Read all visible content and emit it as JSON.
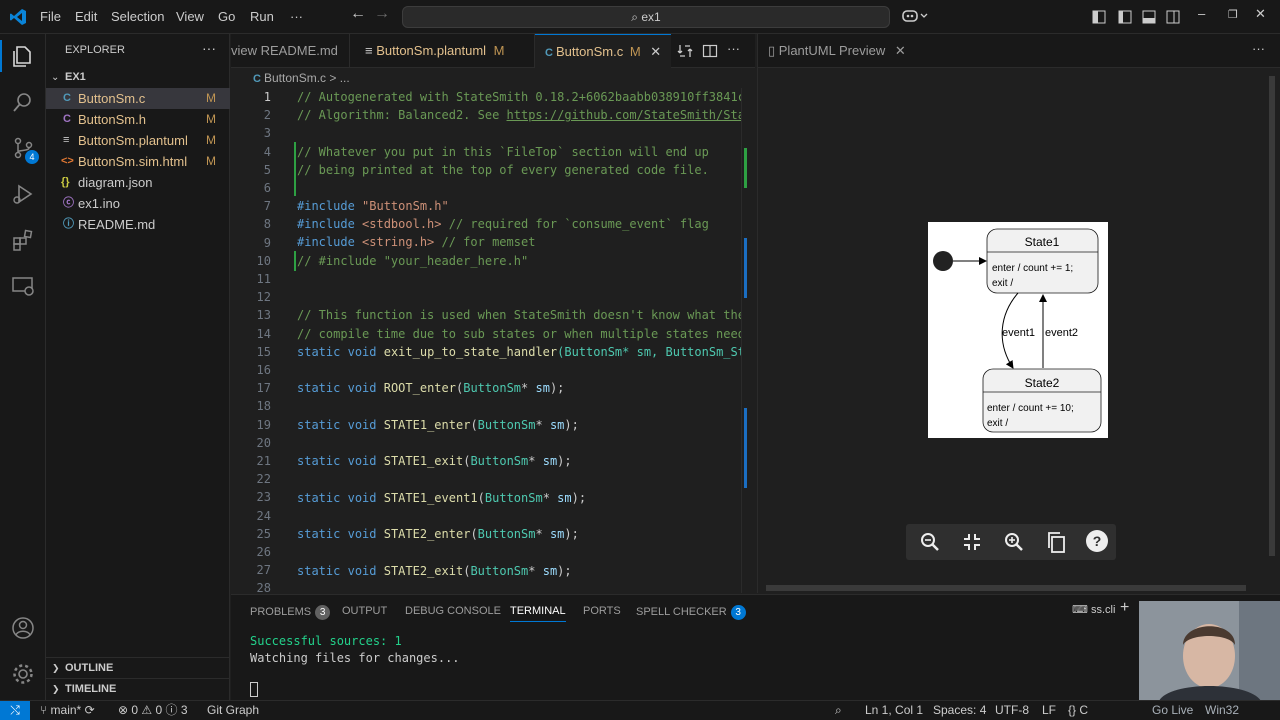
{
  "menu": {
    "file": "File",
    "edit": "Edit",
    "selection": "Selection",
    "view": "View",
    "go": "Go",
    "run": "Run",
    "more": "···"
  },
  "search": {
    "text": "ex1"
  },
  "sidebar": {
    "header": "EXPLORER",
    "more": "···",
    "folder": "EX1",
    "files": [
      {
        "icon": "C",
        "name": "ButtonSm.c",
        "mod": "M"
      },
      {
        "icon": "C",
        "name": "ButtonSm.h",
        "mod": "M"
      },
      {
        "icon": "≡",
        "name": "ButtonSm.plantuml",
        "mod": "M"
      },
      {
        "icon": "<>",
        "name": "ButtonSm.sim.html",
        "mod": "M"
      },
      {
        "icon": "{}",
        "name": "diagram.json",
        "mod": ""
      },
      {
        "icon": "ⓒ",
        "name": "ex1.ino",
        "mod": ""
      },
      {
        "icon": "ⓘ",
        "name": "README.md",
        "mod": ""
      }
    ],
    "outline": "OUTLINE",
    "timeline": "TIMELINE"
  },
  "activity": {
    "scm_badge": "4"
  },
  "tabs": [
    {
      "label": "view README.md",
      "mod": ""
    },
    {
      "label": "ButtonSm.plantuml",
      "mod": "M"
    },
    {
      "label": "ButtonSm.c",
      "mod": "M"
    }
  ],
  "breadcrumb": {
    "file": "ButtonSm.c",
    "sep": "> ..."
  },
  "code": {
    "lines": [
      {
        "n": "1"
      },
      {
        "n": "2"
      },
      {
        "n": "3"
      },
      {
        "n": "4"
      },
      {
        "n": "5"
      },
      {
        "n": "6"
      },
      {
        "n": "7"
      },
      {
        "n": "8"
      },
      {
        "n": "9"
      },
      {
        "n": "10"
      },
      {
        "n": "11"
      },
      {
        "n": "12"
      },
      {
        "n": "13"
      },
      {
        "n": "14"
      },
      {
        "n": "15"
      },
      {
        "n": "16"
      },
      {
        "n": "17"
      },
      {
        "n": "18"
      },
      {
        "n": "19"
      },
      {
        "n": "20"
      },
      {
        "n": "21"
      },
      {
        "n": "22"
      },
      {
        "n": "23"
      },
      {
        "n": "24"
      },
      {
        "n": "25"
      },
      {
        "n": "26"
      },
      {
        "n": "27"
      },
      {
        "n": "28"
      }
    ],
    "l1": "// Autogenerated with StateSmith 0.18.2+6062baabb038910ff3841c",
    "l2a": "// Algorithm: Balanced2. See ",
    "l2b": "https://github.com/StateSmith/Sta",
    "l4": "// Whatever you put in this `FileTop` section will end up",
    "l5": "// being printed at the top of every generated code file.",
    "l7a": "#include ",
    "l7b": "\"ButtonSm.h\"",
    "l8a": "#include ",
    "l8b": "<stdbool.h>",
    "l8c": " // required for `consume_event` flag",
    "l9a": "#include ",
    "l9b": "<string.h>",
    "l9c": " // for memset",
    "l10": "// #include \"your_header_here.h\"",
    "l13": "// This function is used when StateSmith doesn't know what the",
    "l14": "// compile time due to sub states or when multiple states need",
    "static": "static",
    "void": "void",
    "type": "ButtonSm",
    "star": "*",
    "sm": "sm",
    "l15fn": "exit_up_to_state_handler",
    "l15rest": "(ButtonSm* sm, ButtonSm_St",
    "fn17": "ROOT_enter",
    "fn19": "STATE1_enter",
    "fn21": "STATE1_exit",
    "fn23": "STATE1_event1",
    "fn25": "STATE2_enter",
    "fn27": "STATE2_exit"
  },
  "preview": {
    "tab": "PlantUML Preview",
    "more": "···",
    "diagram": {
      "state1": "State1",
      "state1_body1": "enter / count += 1;",
      "state1_body2": "exit /",
      "state2": "State2",
      "state2_body1": "enter / count += 10;",
      "state2_body2": "exit /",
      "event1": "event1",
      "event2": "event2"
    }
  },
  "panel": {
    "problems": "PROBLEMS",
    "problems_count": "3",
    "output": "OUTPUT",
    "debug": "DEBUG CONSOLE",
    "terminal": "TERMINAL",
    "ports": "PORTS",
    "spell": "SPELL CHECKER",
    "spell_count": "3",
    "term_name": "ss.cli",
    "line1": "Successful sources: 1",
    "line2": "Watching files for changes..."
  },
  "status": {
    "branch": "main*",
    "errors": "0",
    "warnings": "0",
    "info": "3",
    "gitgraph": "Git Graph",
    "pos": "Ln 1, Col 1",
    "spaces": "Spaces: 4",
    "enc": "UTF-8",
    "eol": "LF",
    "lang": "C",
    "golive": "Go Live",
    "os": "Win32"
  },
  "colors": {
    "accent": "#0078d4",
    "modified": "#c09553",
    "terminal_green": "#23d18b"
  }
}
